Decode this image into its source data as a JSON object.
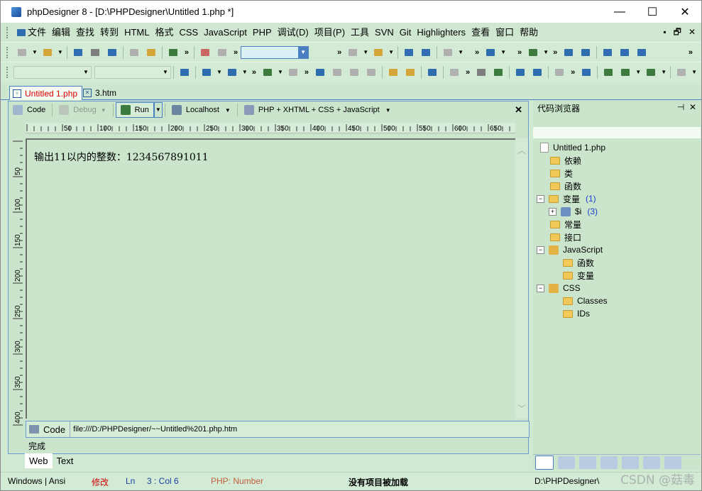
{
  "window": {
    "title": "phpDesigner 8 - [D:\\PHPDesigner\\Untitled 1.php *]",
    "min": "—",
    "max": "☐",
    "close": "✕"
  },
  "menu": {
    "items": [
      "文件",
      "编辑",
      "查找",
      "转到",
      "HTML",
      "格式",
      "CSS",
      "JavaScript",
      "PHP",
      "调试(D)",
      "项目(P)",
      "工具",
      "SVN",
      "Git",
      "Highlighters",
      "查看",
      "窗口",
      "帮助"
    ],
    "mdi_controls": [
      "▪",
      "🗗",
      "✕"
    ]
  },
  "doc_tabs": [
    {
      "label": "Untitled 1.php",
      "active": true
    },
    {
      "label": "3.htm",
      "active": false
    }
  ],
  "editor_toolbar": {
    "code": "Code",
    "debug": "Debug",
    "run": "Run",
    "localhost": "Localhost",
    "mode": "PHP + XHTML + CSS + JavaScript",
    "close": "✕"
  },
  "ruler": {
    "labels": [
      "50",
      "100",
      "150",
      "200",
      "250",
      "300",
      "350",
      "400",
      "450",
      "500",
      "550",
      "600",
      "650"
    ],
    "vlabels": [
      "50",
      "100",
      "150",
      "200",
      "250",
      "300",
      "350",
      "400"
    ]
  },
  "output_text": "输出11以内的整数：1234567891011",
  "url_bar": {
    "label": "Code",
    "url": "file:///D:/PHPDesigner/~~Untitled%201.php.htm"
  },
  "done_text": "完成",
  "bottom_tabs": [
    "Web",
    "Text"
  ],
  "code_browser": {
    "title": "代码浏览器",
    "pin": "⊣",
    "close": "✕",
    "root": "Untitled 1.php",
    "nodes": [
      {
        "label": "依赖"
      },
      {
        "label": "类"
      },
      {
        "label": "函数"
      },
      {
        "label": "变量",
        "count": "(1)"
      },
      {
        "label": "$i",
        "count": "(3)"
      },
      {
        "label": "常量"
      },
      {
        "label": "接口"
      },
      {
        "label": "JavaScript"
      },
      {
        "label": "函数"
      },
      {
        "label": "变量"
      },
      {
        "label": "CSS"
      },
      {
        "label": "Classes"
      },
      {
        "label": "IDs"
      }
    ]
  },
  "status": {
    "encoding": "Windows | Ansi",
    "modified": "修改",
    "ln": "Ln",
    "pos": "3 : Col   6",
    "php": "PHP: Number",
    "project": "没有项目被加载",
    "path": "D:\\PHPDesigner\\"
  },
  "watermark": "CSDN @菇毒",
  "colors": {
    "bg": "#cfe9d3",
    "accent": "#4a7fc1",
    "modified": "#d00000",
    "php_status": "#c06040"
  }
}
